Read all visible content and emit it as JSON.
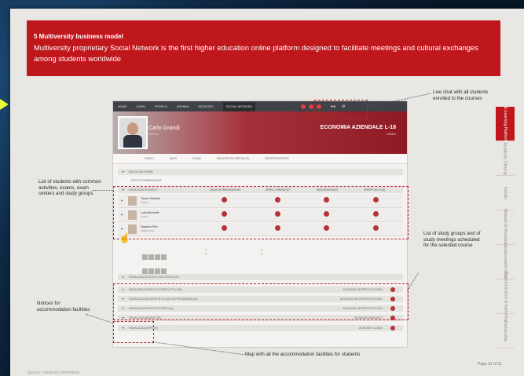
{
  "slide": {
    "section_title": "5 Multiversity business model",
    "headline": "Multiversity proprietary Social Network is the first higher education online platform designed to facilitate meetings and cultural exchanges among students worldwide",
    "colors": {
      "brand_red": "#c0171d",
      "text_dark": "#2b2b2b",
      "page_bg": "#e9e7e4"
    },
    "source_label": "Source: Company information",
    "page_label": "Page 31 of 31"
  },
  "side_tabs": [
    {
      "label": "E-Learning Platform",
      "active": true
    },
    {
      "label": "Academic Offering",
      "active": false
    },
    {
      "label": "Faculty",
      "active": false
    },
    {
      "label": "Network & Hospitality",
      "active": false
    },
    {
      "label": "Employment Office",
      "active": false
    },
    {
      "label": "Communication & marketing",
      "active": false
    },
    {
      "label": "Partnership",
      "active": false
    }
  ],
  "annotations": {
    "live_chat": "Live chat with all students enrolled to the courses",
    "students_list": "List of students with common activities, exams, exam centers and study groups",
    "study_groups": "List of study groups and of study meetings scheduled for the selected course",
    "notices": "Notices for accommodation facilities",
    "map": "Map with all the accommodation facilities for students"
  },
  "screenshot": {
    "nav_items": [
      "HOME",
      "CORSI",
      "PROFILO",
      "AGENDA",
      "REGISTRO",
      "SOCIAL NETWORK"
    ],
    "nav_selected": "SOCIAL NETWORK",
    "user_name": "Carlo Grandi",
    "user_location": "NAPOLI",
    "course_title": "ECONOMIA AZIENDALE L-18",
    "course_year": "1 ANNO",
    "subnav": [
      "DIARIO",
      "AMICI",
      "ESAMI",
      "SEDI/CENTRI OSPITALITA",
      "GRUPPI/INCONTRI"
    ],
    "exam_bar": "SELEZIONA ESAME",
    "exam_value": "DIRITTO COMMERCIALE",
    "students_bar": "VISUALIZZA STUDENTI",
    "columns": [
      "ESAMI IN PREPARAZIONE",
      "APPELLI PRENOTATI",
      "SEDI ASSEGNATE",
      "GRUPPI AUTO (N)"
    ],
    "students": [
      {
        "name": "Tiziano Gallifardi",
        "detail": "NAPOLI"
      },
      {
        "name": "Lucia Benedetti",
        "detail": "NAPOLI"
      },
      {
        "name": "Massimo Pirro",
        "detail": "CREMA 1000"
      }
    ],
    "bottom_bars": [
      {
        "label": "VISUALIZZA STUDENTI SUCCESSIVI (N)",
        "right_label": "",
        "has_dot": false
      },
      {
        "label": "VISUALIZZA GRUPPI DI STUDIO ATTIVI (N)",
        "right_label": "AGGIUNGI GRUPPO DI STUDIO",
        "has_dot": true
      },
      {
        "label": "VISUALIZZA INCONTRI DI STUDIO IN PROGRAMMA (N)",
        "right_label": "AGGIUNGI INCONTRO DI STUDIO",
        "has_dot": true
      },
      {
        "label": "VISUALIZZA GRUPPI DI STUDIO (N)",
        "right_label": "AGGIUNGI GRUPPO DI STUDIO",
        "has_dot": true
      },
      {
        "label": "VISUALIZZA ANNUNCI (N)",
        "right_label": "AGGIUNGI ANNUNCIO",
        "has_dot": true
      },
      {
        "label": "VISUALIZZA MAPPA (N)",
        "right_label": "AGGIUNGI LUOGO",
        "has_dot": true
      }
    ]
  }
}
